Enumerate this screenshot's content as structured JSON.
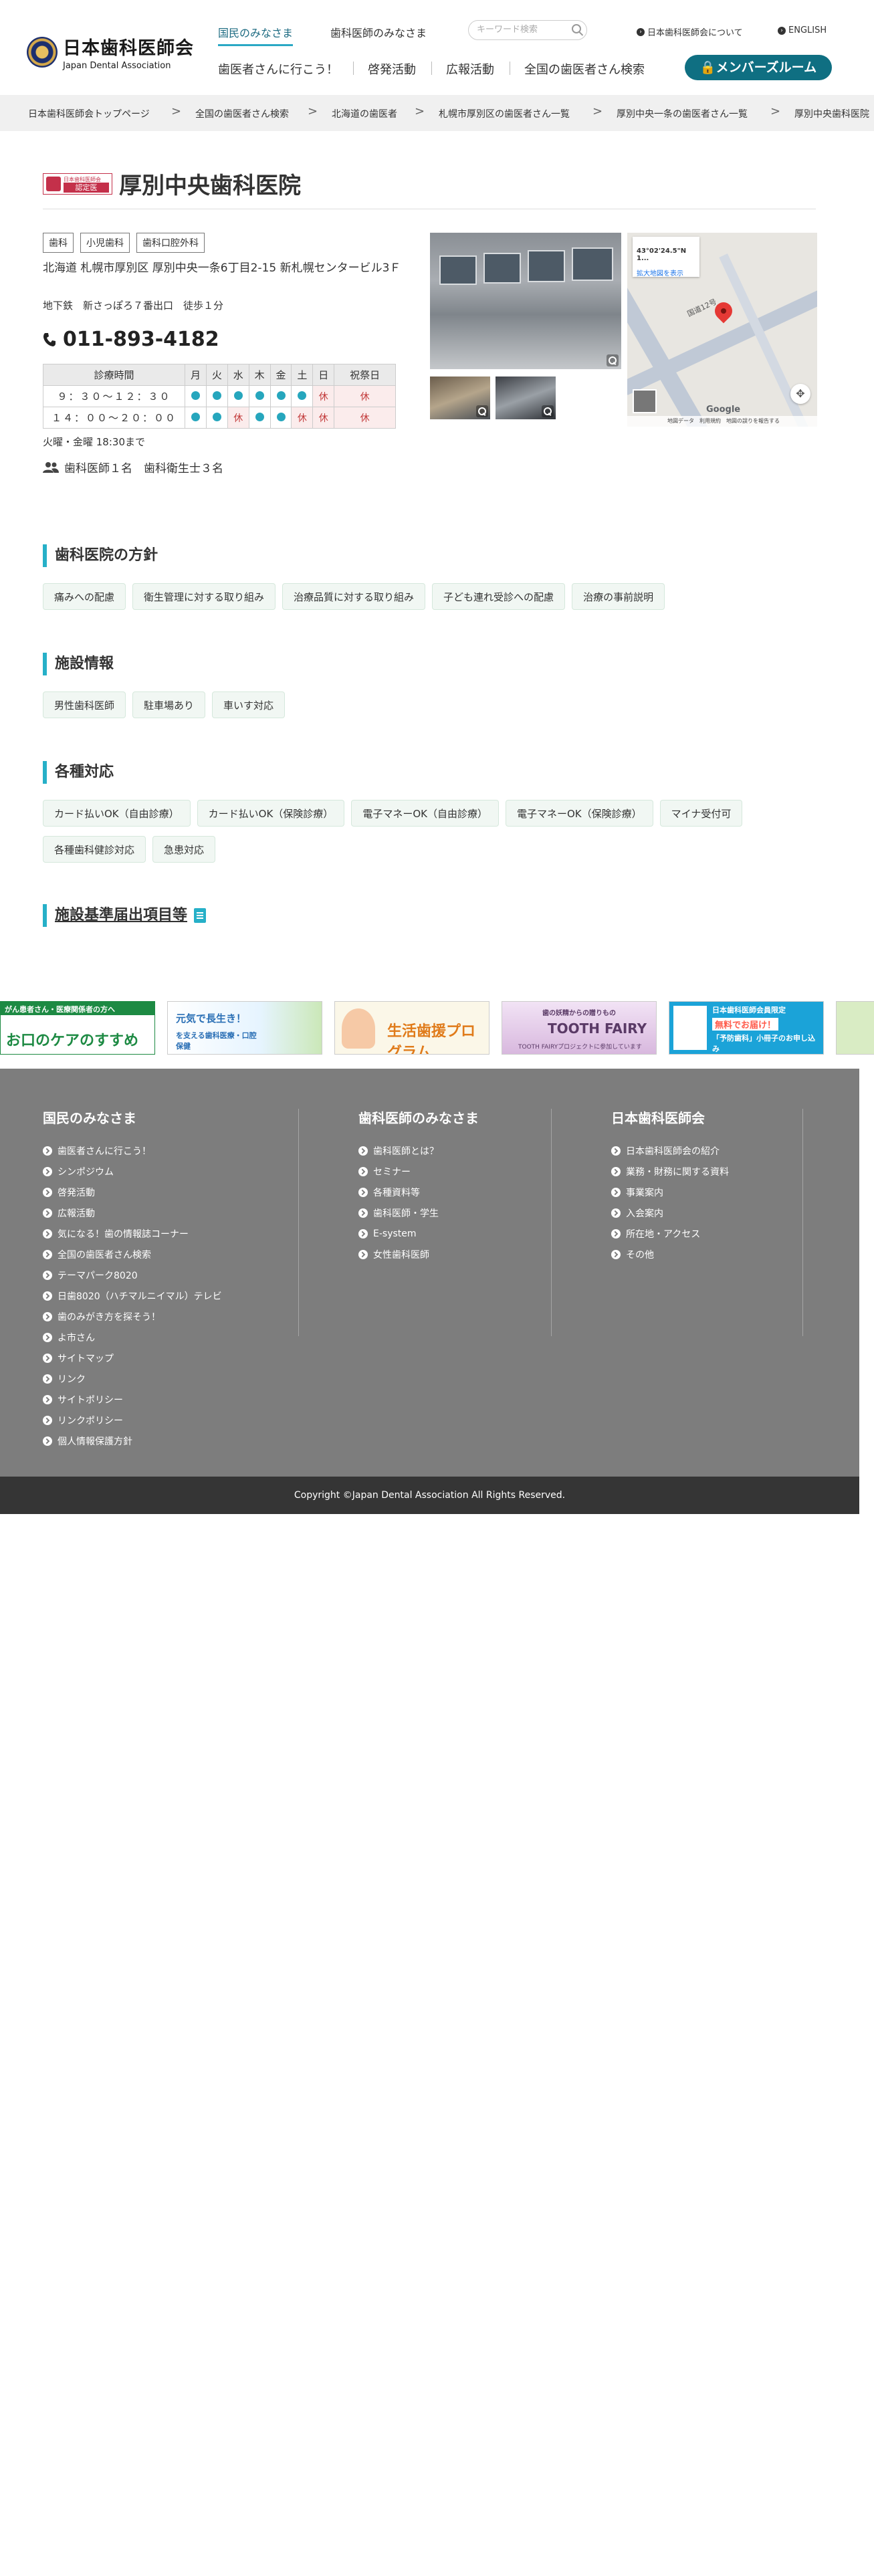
{
  "header": {
    "logo_ja": "日本歯科医師会",
    "logo_en": "Japan Dental Association",
    "nav_top": [
      "国民のみなさま",
      "歯科医師のみなさま"
    ],
    "search_placeholder": "キーワード検索",
    "util_links": [
      "日本歯科医師会について",
      "ENGLISH"
    ],
    "nav_main": [
      "歯医者さんに行こう！",
      "啓発活動",
      "広報活動",
      "全国の歯医者さん検索"
    ],
    "member_room": "メンバーズルーム"
  },
  "breadcrumb": [
    "日本歯科医師会トップページ",
    "全国の歯医者さん検索",
    "北海道の歯医者",
    "札幌市厚別区の歯医者さん一覧",
    "厚別中央一条の歯医者さん一覧",
    "厚別中央歯科医院"
  ],
  "clinic": {
    "badge_top": "日本歯科医師会",
    "badge_label": "認定医",
    "name": "厚別中央歯科医院",
    "tags": [
      "歯科",
      "小児歯科",
      "歯科口腔外科"
    ],
    "address": "北海道 札幌市厚別区 厚別中央一条6丁目2-15 新札幌センタービル3Ｆ",
    "access": "地下鉄　新さっぽろ７番出口　徒歩１分",
    "phone": "011-893-4182",
    "hours_header": {
      "time": "診療時間",
      "days": [
        "月",
        "火",
        "水",
        "木",
        "金",
        "土",
        "日",
        "祝祭日"
      ]
    },
    "hours_rows": [
      {
        "time": "９：３０～１２：３０",
        "cells": [
          "open",
          "open",
          "open",
          "open",
          "open",
          "open",
          "休",
          "休"
        ]
      },
      {
        "time": "１４：００～２０：００",
        "cells": [
          "open",
          "open",
          "休",
          "open",
          "open",
          "休",
          "休",
          "休"
        ]
      }
    ],
    "hours_note": "火曜・金曜 18:30まで",
    "staff": "歯科医師１名　歯科衛生士３名"
  },
  "map": {
    "coords": "43°02'24.5\"N 1...",
    "link": "拡大地図を表示",
    "road": "国道12号",
    "google": "Google",
    "footer": "地図データ　利用規約　地図の誤りを報告する"
  },
  "sections": {
    "policy": {
      "title": "歯科医院の方針",
      "items": [
        "痛みへの配慮",
        "衛生管理に対する取り組み",
        "治療品質に対する取り組み",
        "子ども連れ受診への配慮",
        "治療の事前説明"
      ]
    },
    "facility": {
      "title": "施設情報",
      "items": [
        "男性歯科医師",
        "駐車場あり",
        "車いす対応"
      ]
    },
    "support": {
      "title": "各種対応",
      "items": [
        "カード払いOK（自由診療）",
        "カード払いOK（保険診療）",
        "電子マネーOK（自由診療）",
        "電子マネーOK（保険診療）",
        "マイナ受付可",
        "各種歯科健診対応",
        "急患対応"
      ]
    },
    "standards": {
      "title": "施設基準届出項目等"
    }
  },
  "banners": [
    {
      "line1": "がん患者さん・医療関係者の方へ",
      "line2": "お口のケアのすすめ"
    },
    {
      "line1": "元気で長生き！",
      "line2": "を支える歯科医療・口腔保健"
    },
    {
      "line1": "生活歯援プログラム"
    },
    {
      "line1": "歯の妖精からの贈りもの",
      "line2": "TOOTH FAIRY",
      "line3": "TOOTH FAIRYプロジェクトに参加しています"
    },
    {
      "line1": "日本歯科医師会員限定",
      "line2": "無料でお届け！",
      "line3": "「予防歯科」小冊子のお申し込み"
    }
  ],
  "footer": {
    "col1": {
      "title": "国民のみなさま",
      "items": [
        "歯医者さんに行こう！",
        "シンポジウム",
        "啓発活動",
        "広報活動",
        "気になる！歯の情報誌コーナー",
        "全国の歯医者さん検索",
        "テーマパーク8020",
        "日歯8020（ハチマルニイマル）テレビ",
        "歯のみがき方を探そう！",
        "よ市さん",
        "サイトマップ",
        "リンク",
        "サイトポリシー",
        "リンクポリシー",
        "個人情報保護方針"
      ]
    },
    "col2": {
      "title": "歯科医師のみなさま",
      "items": [
        "歯科医師とは？",
        "セミナー",
        "各種資料等",
        "歯科医師・学生",
        "E-system",
        "女性歯科医師"
      ]
    },
    "col3": {
      "title": "日本歯科医師会",
      "items": [
        "日本歯科医師会の紹介",
        "業務・財務に関する資料",
        "事業案内",
        "入会案内",
        "所在地・アクセス",
        "その他"
      ]
    },
    "copyright": "Copyright ©Japan Dental Association All Rights Reserved."
  },
  "colors": {
    "accent": "#26b0c8",
    "member": "#0f6f82",
    "footer": "#7d7d7d",
    "copy": "#353535",
    "holiday": "#c23a3a"
  }
}
